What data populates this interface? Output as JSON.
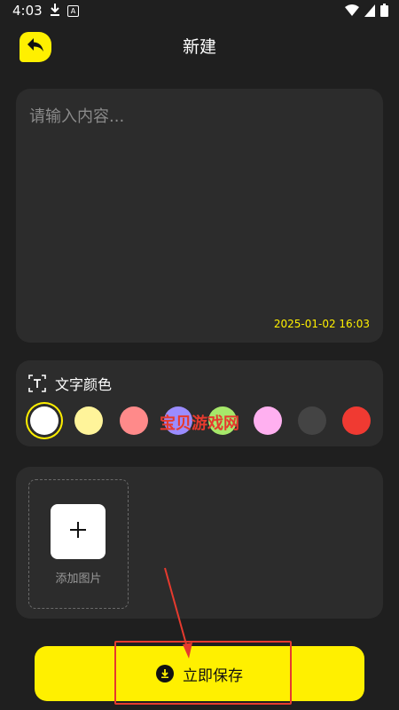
{
  "status_bar": {
    "time": "4:03",
    "icons": [
      "download-icon",
      "a-icon",
      "wifi-icon",
      "signal-icon",
      "battery-icon"
    ]
  },
  "header": {
    "title": "新建",
    "back_icon": "reply-icon"
  },
  "text_panel": {
    "placeholder": "请输入内容...",
    "datetime": "2025-01-02  16:03"
  },
  "color_panel": {
    "label": "文字颜色",
    "icon": "text-frame-icon",
    "swatches": [
      {
        "color": "#ffffff",
        "selected": true
      },
      {
        "color": "#fff49a",
        "selected": false
      },
      {
        "color": "#ff8a8a",
        "selected": false
      },
      {
        "color": "#9b8cff",
        "selected": false
      },
      {
        "color": "#a6e86a",
        "selected": false
      },
      {
        "color": "#ffb0f0",
        "selected": false
      },
      {
        "color": "#444444",
        "selected": false
      },
      {
        "color": "#f03a32",
        "selected": false
      }
    ]
  },
  "image_panel": {
    "add_label": "添加图片"
  },
  "save_button": {
    "label": "立即保存",
    "icon": "download-circle-icon"
  },
  "watermark": "宝贝游戏网",
  "colors": {
    "accent": "#fff000",
    "background": "#1f1f1f",
    "panel": "#2c2c2c",
    "annotation": "#e63a2e"
  }
}
